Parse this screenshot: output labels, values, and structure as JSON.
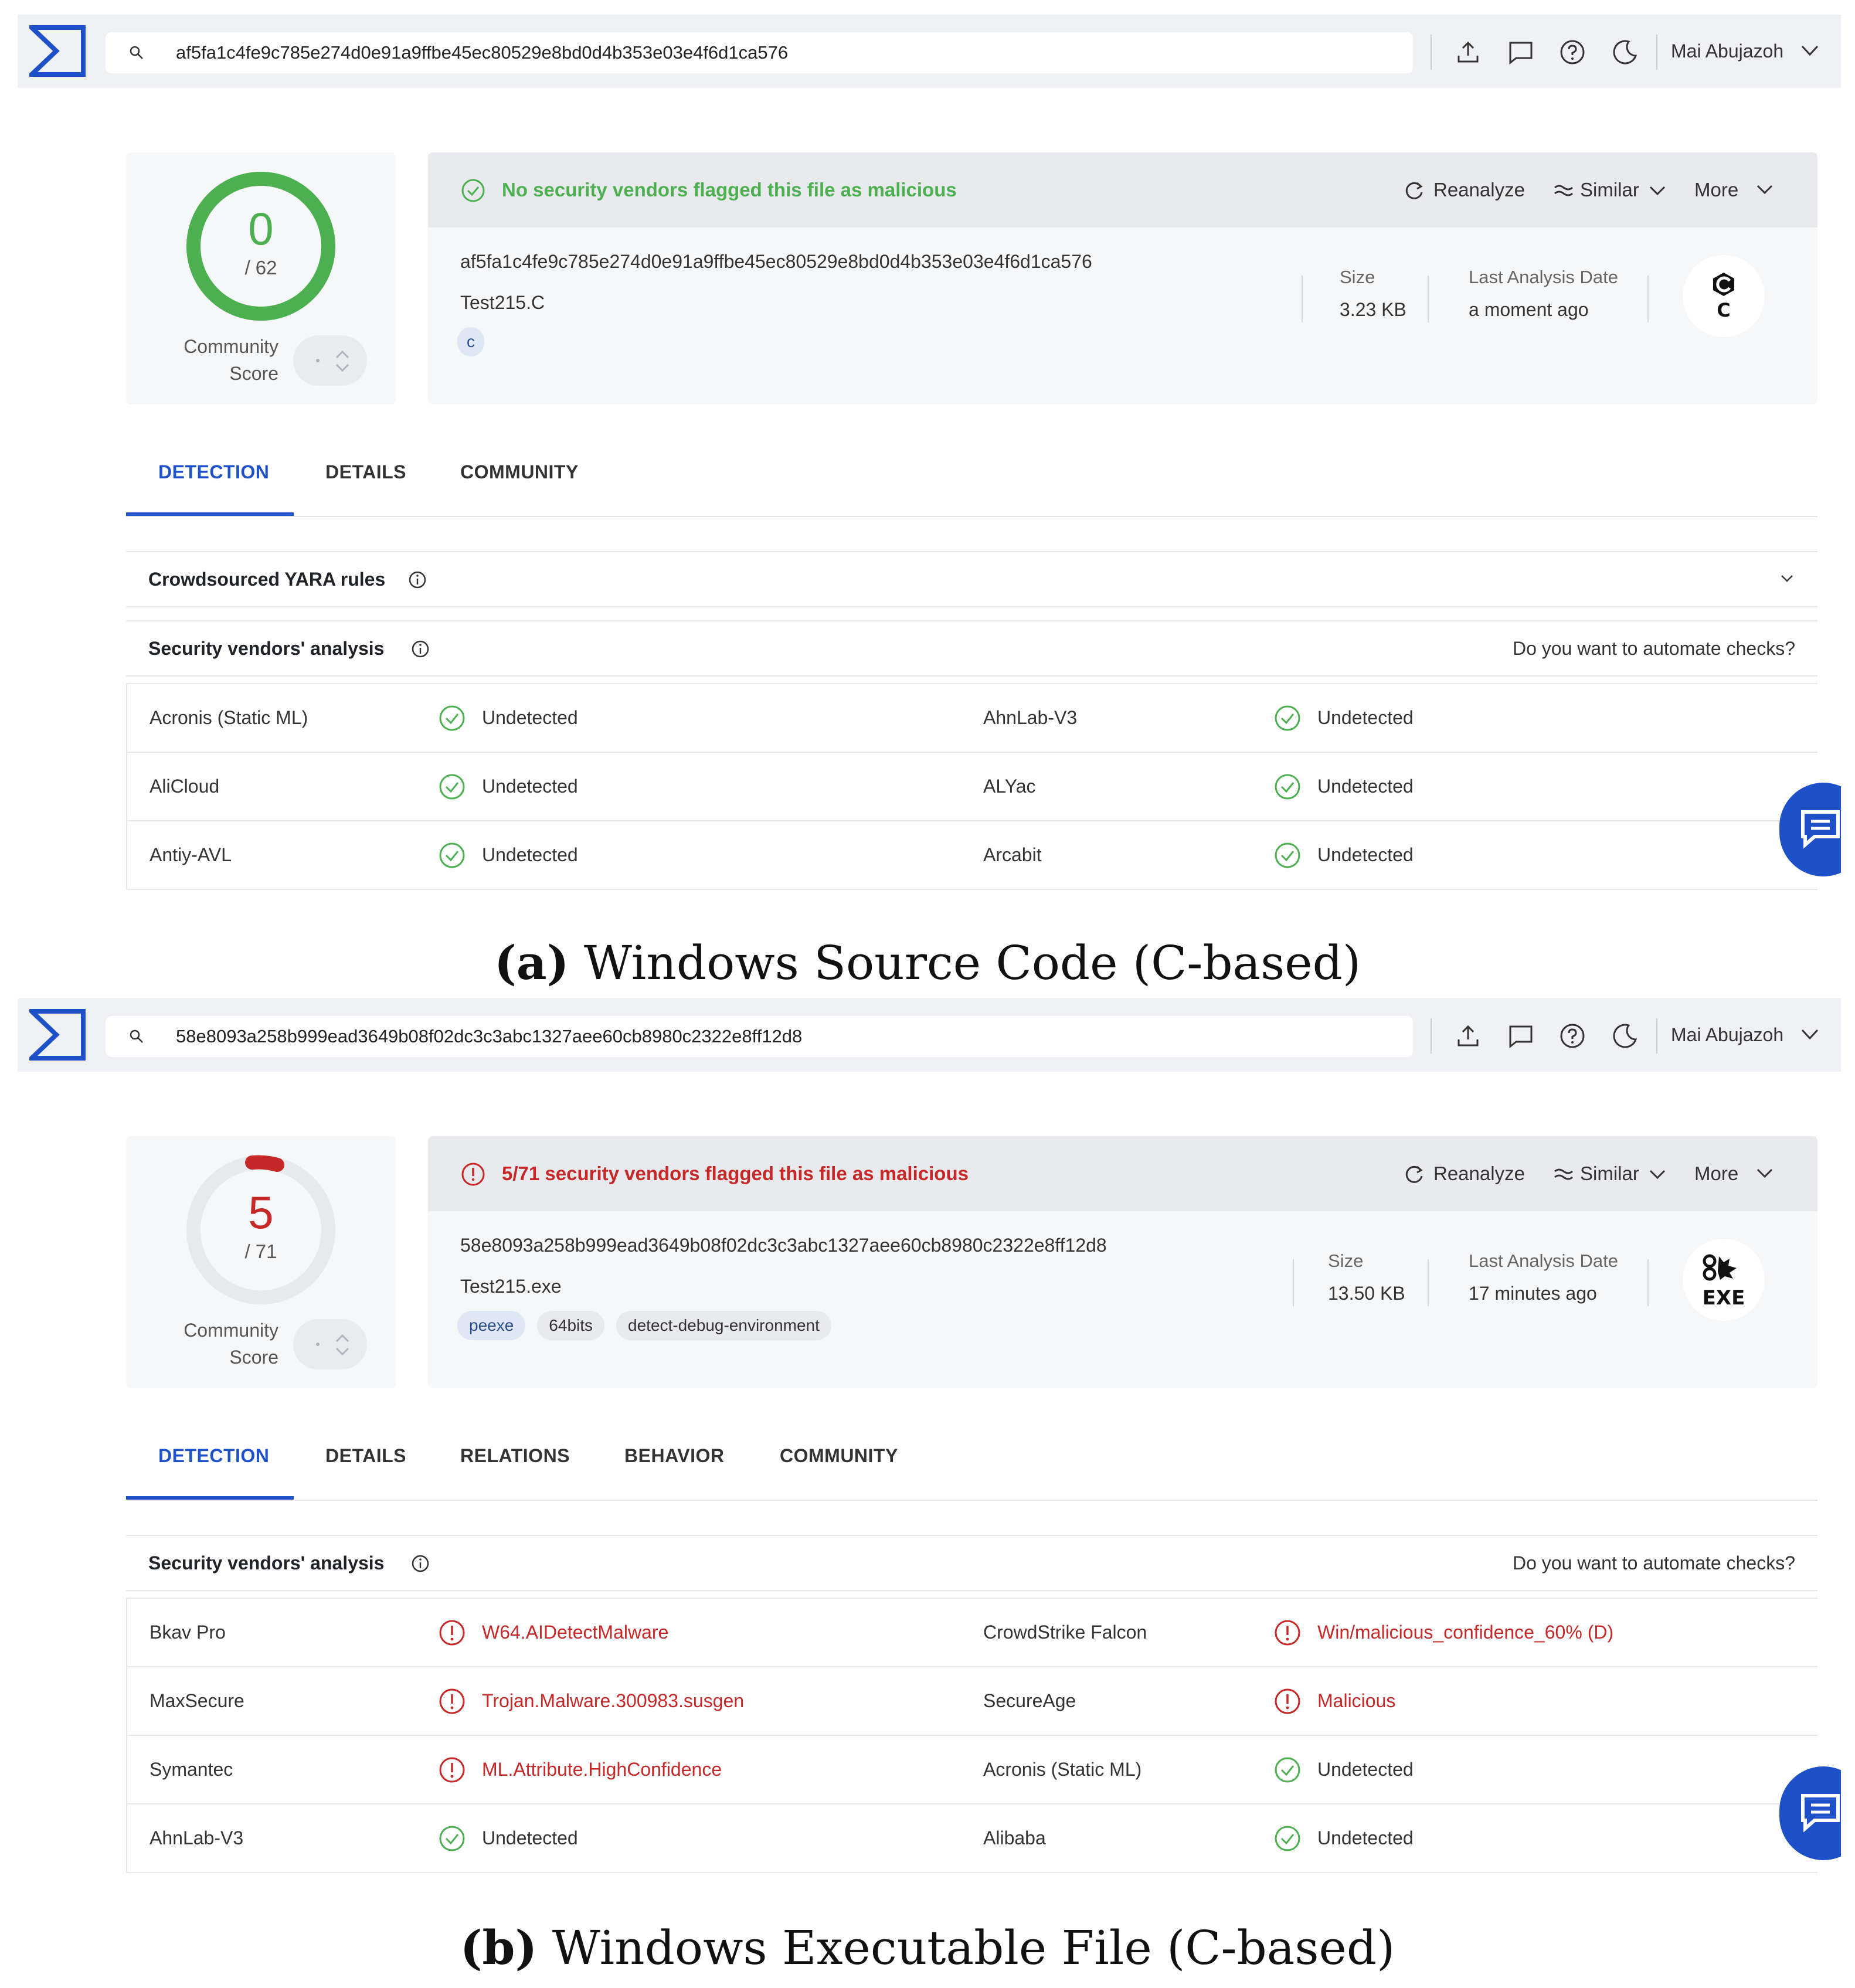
{
  "colors": {
    "accent": "#1e50c8",
    "clean": "#4caf50",
    "malicious": "#c62828",
    "banner_bg": "#e9eaed"
  },
  "panels": [
    {
      "search_value": "af5fa1c4fe9c785e274d0e91a9ffbe45ec80529e8bd0d4b353e03e4f6d1ca576",
      "user_name": "Mai Abujazoh",
      "score": {
        "value": "0",
        "total": "/ 62",
        "detected": 0,
        "total_count": 62,
        "label_line1": "Community",
        "label_line2": "Score"
      },
      "banner": {
        "status": "clean",
        "text": "No security vendors flagged this file as malicious"
      },
      "actions": {
        "reanalyze": "Reanalyze",
        "similar": "Similar",
        "more": "More"
      },
      "file": {
        "hash": "af5fa1c4fe9c785e274d0e91a9ffbe45ec80529e8bd0d4b353e03e4f6d1ca576",
        "name": "Test215.C",
        "tags": [
          "c"
        ],
        "size_label": "Size",
        "size_value": "3.23 KB",
        "date_label": "Last Analysis Date",
        "date_value": "a moment ago",
        "type_label": "C",
        "type_icon": "c-file-icon"
      },
      "tabs": [
        "DETECTION",
        "DETAILS",
        "COMMUNITY"
      ],
      "sections": {
        "yara": "Crowdsourced YARA rules",
        "vendors": "Security vendors' analysis",
        "automate": "Do you want to automate checks?"
      },
      "vendors": [
        {
          "left_name": "Acronis (Static ML)",
          "left_result": "Undetected",
          "left_status": "ok",
          "right_name": "AhnLab-V3",
          "right_result": "Undetected",
          "right_status": "ok"
        },
        {
          "left_name": "AliCloud",
          "left_result": "Undetected",
          "left_status": "ok",
          "right_name": "ALYac",
          "right_result": "Undetected",
          "right_status": "ok"
        },
        {
          "left_name": "Antiy-AVL",
          "left_result": "Undetected",
          "left_status": "ok",
          "right_name": "Arcabit",
          "right_result": "Undetected",
          "right_status": "ok"
        }
      ],
      "caption_letter": "(a)",
      "caption_text": " Windows Source Code (C-based)"
    },
    {
      "search_value": "58e8093a258b999ead3649b08f02dc3c3abc1327aee60cb8980c2322e8ff12d8",
      "user_name": "Mai Abujazoh",
      "score": {
        "value": "5",
        "total": "/ 71",
        "detected": 5,
        "total_count": 71,
        "label_line1": "Community",
        "label_line2": "Score"
      },
      "banner": {
        "status": "malicious",
        "text": "5/71 security vendors flagged this file as malicious"
      },
      "actions": {
        "reanalyze": "Reanalyze",
        "similar": "Similar",
        "more": "More"
      },
      "file": {
        "hash": "58e8093a258b999ead3649b08f02dc3c3abc1327aee60cb8980c2322e8ff12d8",
        "name": "Test215.exe",
        "tags": [
          "peexe",
          "64bits",
          "detect-debug-environment"
        ],
        "size_label": "Size",
        "size_value": "13.50 KB",
        "date_label": "Last Analysis Date",
        "date_value": "17 minutes ago",
        "type_label": "EXE",
        "type_icon": "exe-file-icon"
      },
      "tabs": [
        "DETECTION",
        "DETAILS",
        "RELATIONS",
        "BEHAVIOR",
        "COMMUNITY"
      ],
      "sections": {
        "vendors": "Security vendors' analysis",
        "automate": "Do you want to automate checks?"
      },
      "vendors": [
        {
          "left_name": "Bkav Pro",
          "left_result": "W64.AIDetectMalware",
          "left_status": "bad",
          "right_name": "CrowdStrike Falcon",
          "right_result": "Win/malicious_confidence_60% (D)",
          "right_status": "bad"
        },
        {
          "left_name": "MaxSecure",
          "left_result": "Trojan.Malware.300983.susgen",
          "left_status": "bad",
          "right_name": "SecureAge",
          "right_result": "Malicious",
          "right_status": "bad"
        },
        {
          "left_name": "Symantec",
          "left_result": "ML.Attribute.HighConfidence",
          "left_status": "bad",
          "right_name": "Acronis (Static ML)",
          "right_result": "Undetected",
          "right_status": "ok"
        },
        {
          "left_name": "AhnLab-V3",
          "left_result": "Undetected",
          "left_status": "ok",
          "right_name": "Alibaba",
          "right_result": "Undetected",
          "right_status": "ok"
        }
      ],
      "caption_letter": "(b)",
      "caption_text": " Windows Executable File (C-based)"
    }
  ]
}
